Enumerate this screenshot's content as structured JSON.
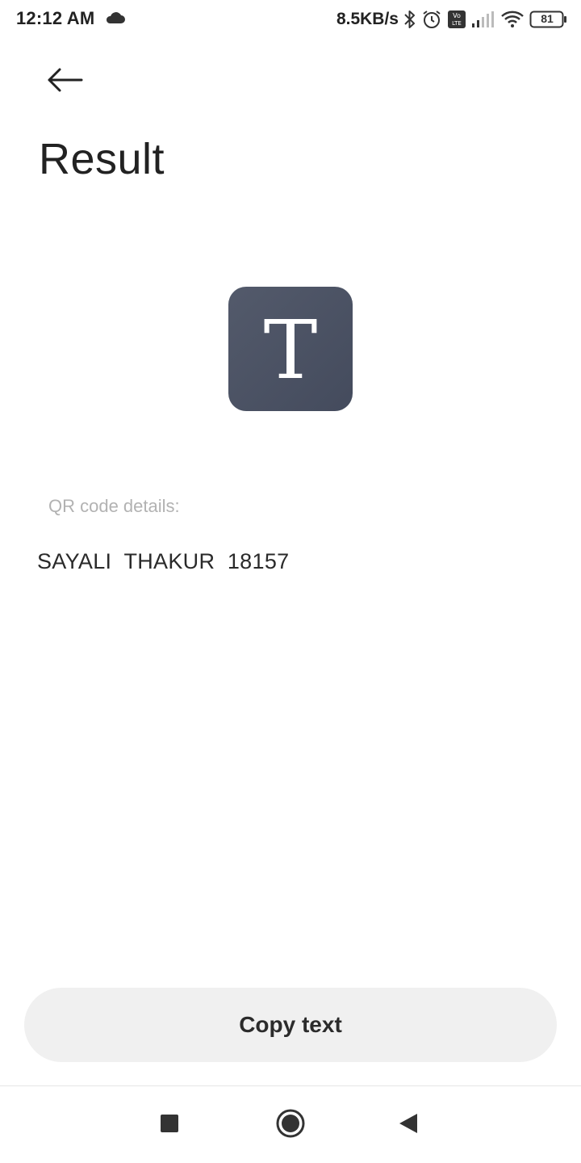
{
  "status_bar": {
    "time": "12:12 AM",
    "network_speed": "8.5KB/s",
    "battery_level": "81",
    "icons": [
      "cloud-icon",
      "bluetooth-icon",
      "alarm-icon",
      "volte-icon",
      "signal-icon",
      "wifi-icon",
      "battery-icon"
    ]
  },
  "header": {
    "title": "Result",
    "back_icon": "arrow-left-icon"
  },
  "result": {
    "type_glyph": "T",
    "type_icon_color": "#4b5163",
    "details_label": "QR code details:",
    "details_value": "SAYALI  THAKUR  18157"
  },
  "actions": {
    "copy_label": "Copy text"
  },
  "nav_bar": {
    "icons": [
      "recents-icon",
      "home-icon",
      "back-triangle-icon"
    ]
  }
}
